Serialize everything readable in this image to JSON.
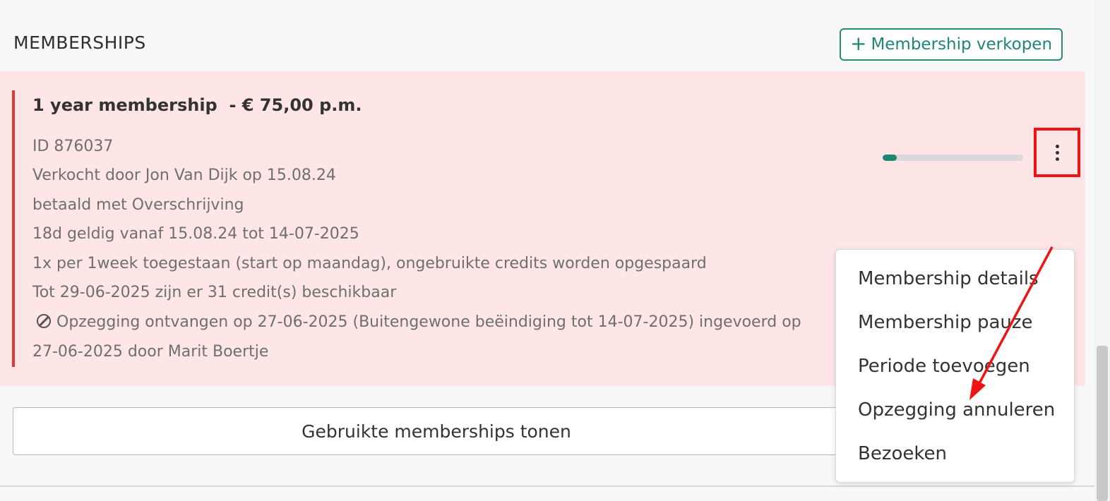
{
  "section": {
    "title": "MEMBERSHIPS",
    "sell_button_icon": "plus-icon",
    "sell_button_label": "Membership verkopen"
  },
  "membership": {
    "title": "1 year membership  - € 75,00 p.m.",
    "details": [
      "ID 876037",
      "Verkocht door Jon Van Dijk op 15.08.24",
      "betaald met Overschrijving",
      "18d geldig vanaf 15.08.24 tot 14-07-2025",
      "1x per 1week toegestaan (start op maandag), ongebruikte credits worden opgespaard",
      "Tot 29-06-2025 zijn er 31 credit(s) beschikbaar"
    ],
    "cancellation_icon": "cancel-icon",
    "cancellation_line1": "Opzegging ontvangen op 27-06-2025 (Buitengewone beëindiging tot 14-07-2025) ingevoerd op",
    "cancellation_line2": "27-06-2025 door Marit Boertje",
    "progress_fraction": 0.1,
    "menu_icon": "kebab-menu-icon"
  },
  "context_menu": {
    "items": [
      "Membership details",
      "Membership pauze",
      "Periode toevoegen",
      "Opzegging annuleren",
      "Bezoeken"
    ]
  },
  "used_button_label": "Gebruikte memberships tonen",
  "colors": {
    "accent": "#1e8574",
    "card_background": "#fee6e6",
    "card_bar": "#e53935",
    "annotation": "#ef1414"
  }
}
